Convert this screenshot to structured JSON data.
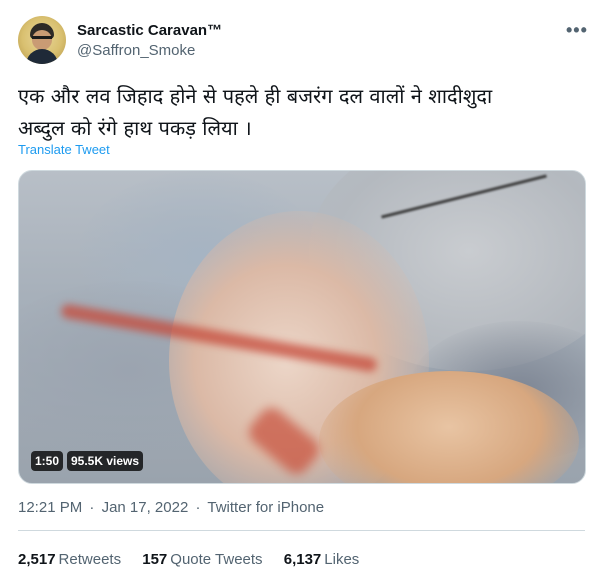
{
  "author": {
    "display_name": "Sarcastic Caravan™",
    "handle": "@Saffron_Smoke"
  },
  "more_menu": "•••",
  "tweet": {
    "text_line1": "एक और लव जिहाद होने से पहले ही बजरंग दल वालों ने शादीशुदा",
    "text_line2": "अब्दुल को रंगे हाथ पकड़ लिया ।",
    "translate": "Translate Tweet"
  },
  "media": {
    "duration": "1:50",
    "views": "95.5K views"
  },
  "meta": {
    "time": "12:21 PM",
    "separator": "·",
    "date": "Jan 17, 2022",
    "source": "Twitter for iPhone"
  },
  "stats": {
    "retweets_count": "2,517",
    "retweets_label": "Retweets",
    "quotes_count": "157",
    "quotes_label": "Quote Tweets",
    "likes_count": "6,137",
    "likes_label": "Likes"
  },
  "colors": {
    "link": "#1d9bf0",
    "secondary_text": "#536471",
    "primary_text": "#0f1419"
  }
}
